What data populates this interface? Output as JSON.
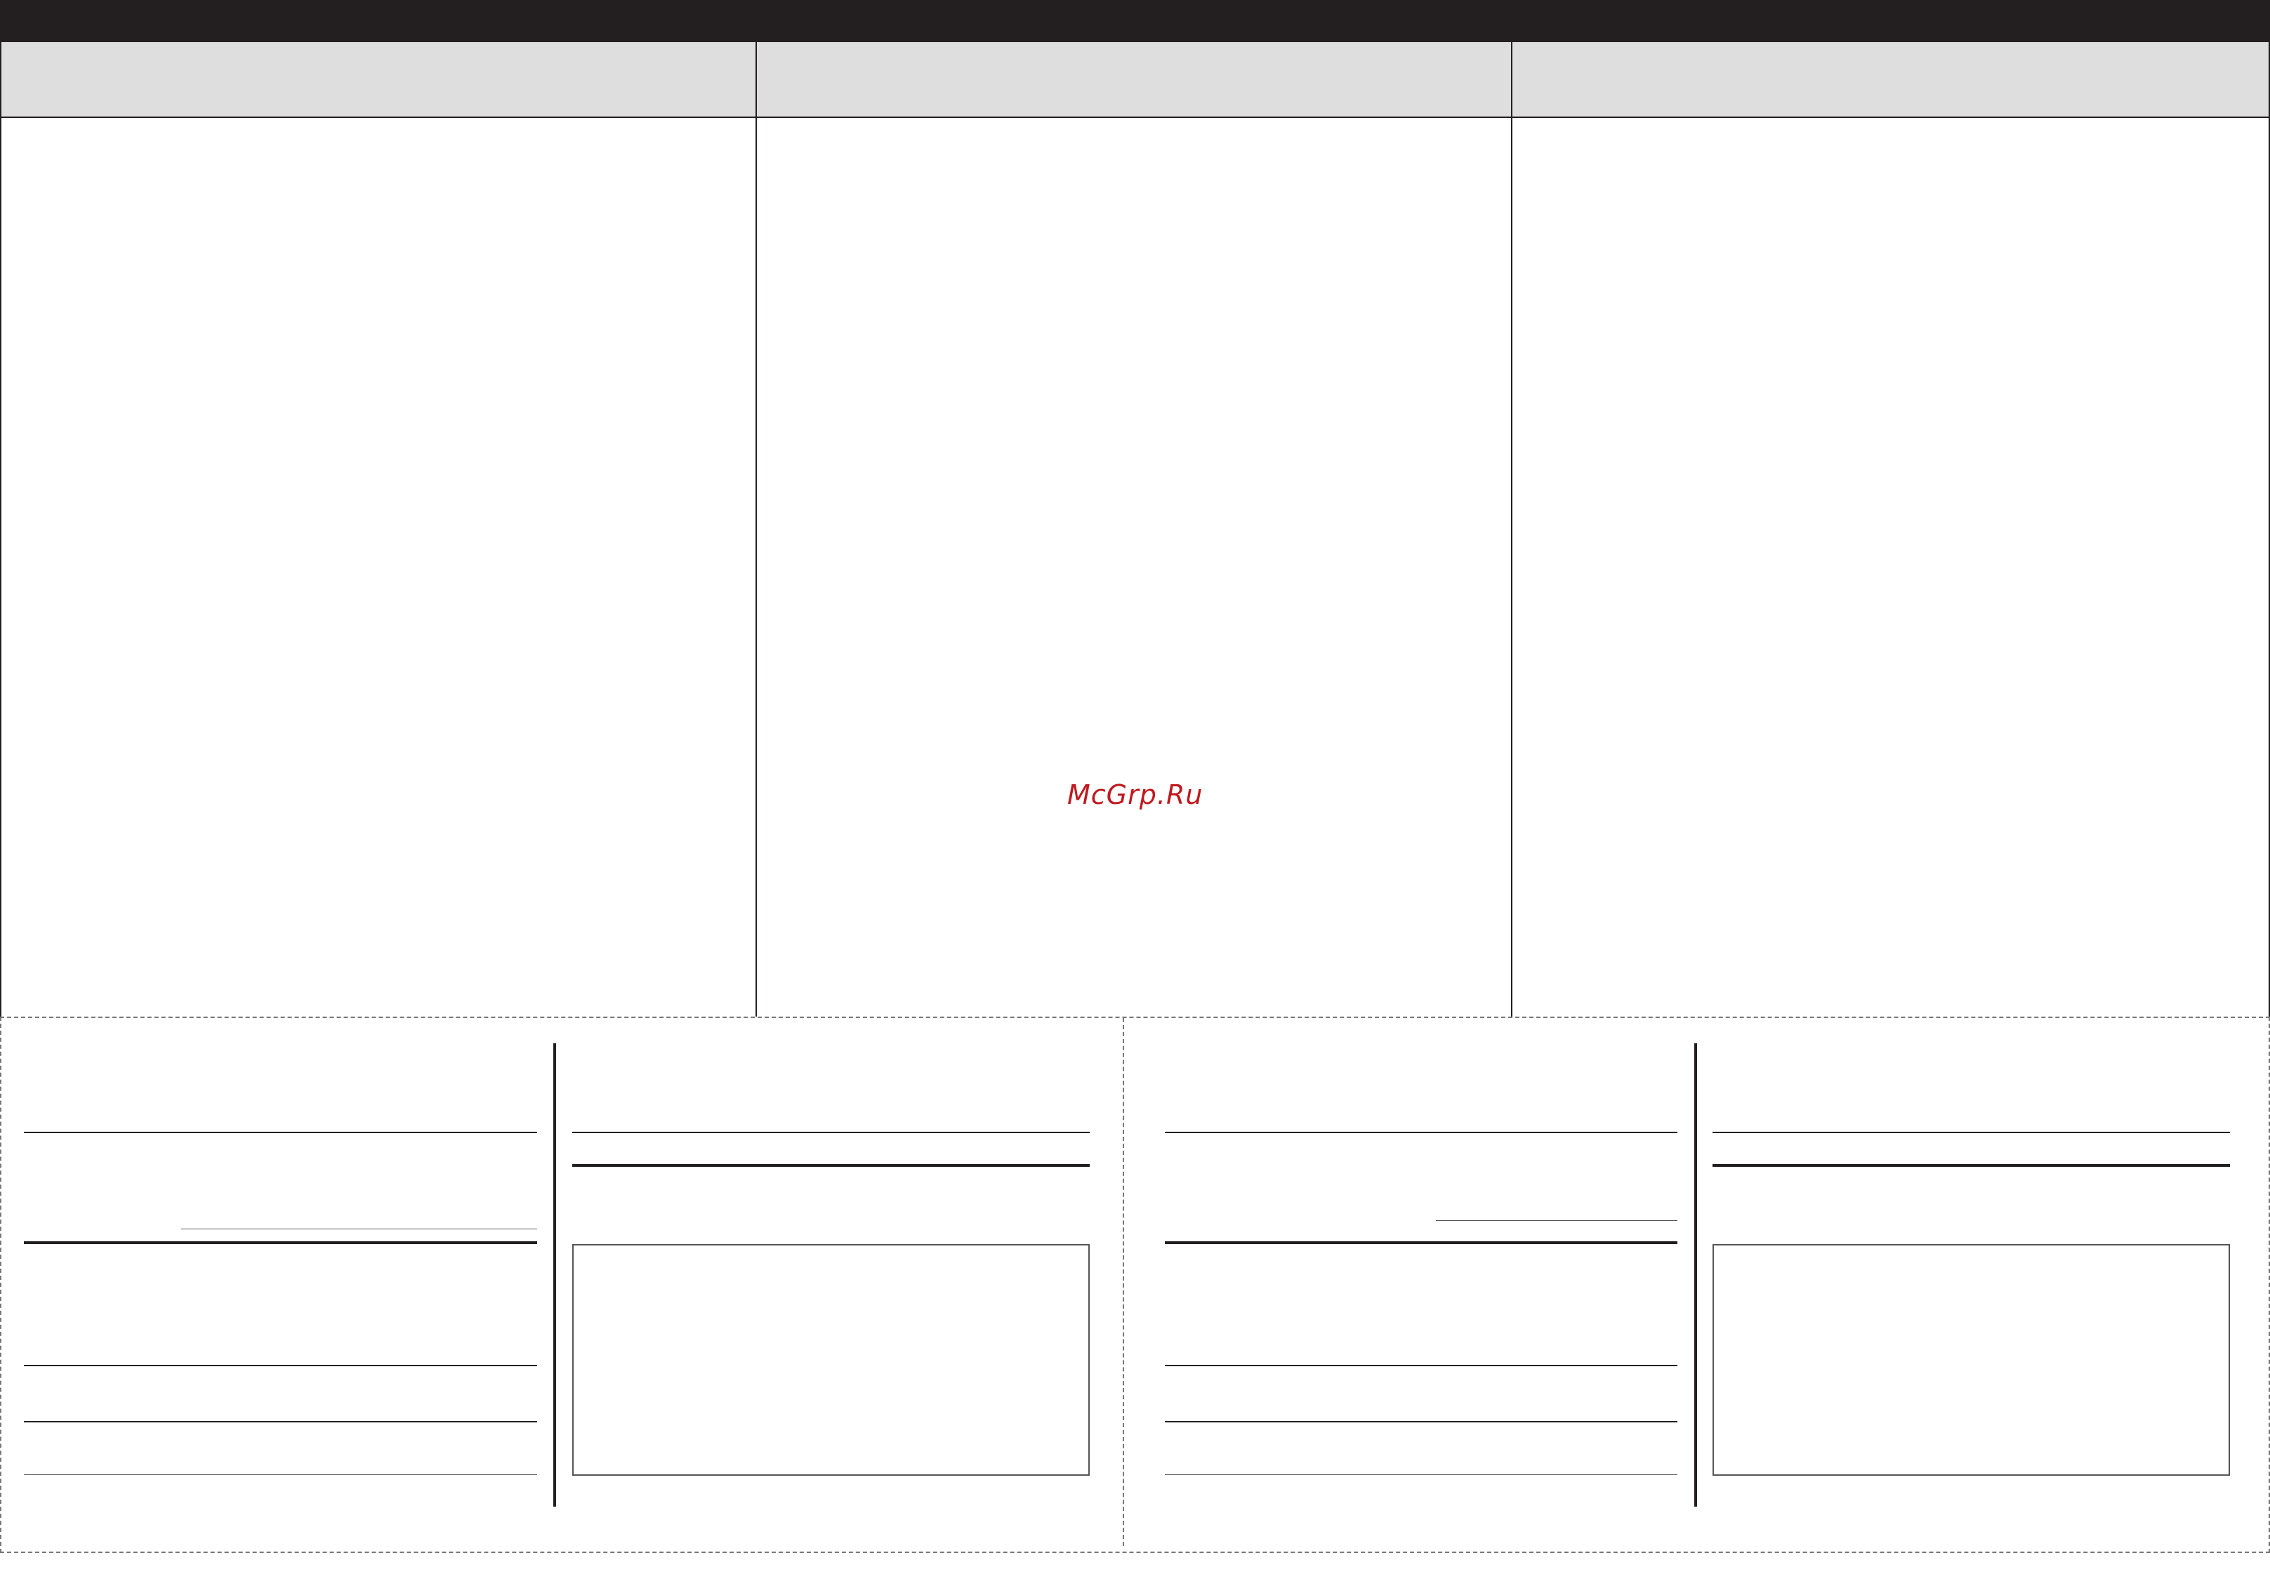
{
  "watermark": {
    "text": "McGrp.Ru",
    "color": "#c0191f"
  },
  "colors": {
    "header_bar": "#231f20",
    "subheader_fill": "#dedede",
    "rule": "#231f20",
    "dashed_cut_line": "#777777"
  }
}
